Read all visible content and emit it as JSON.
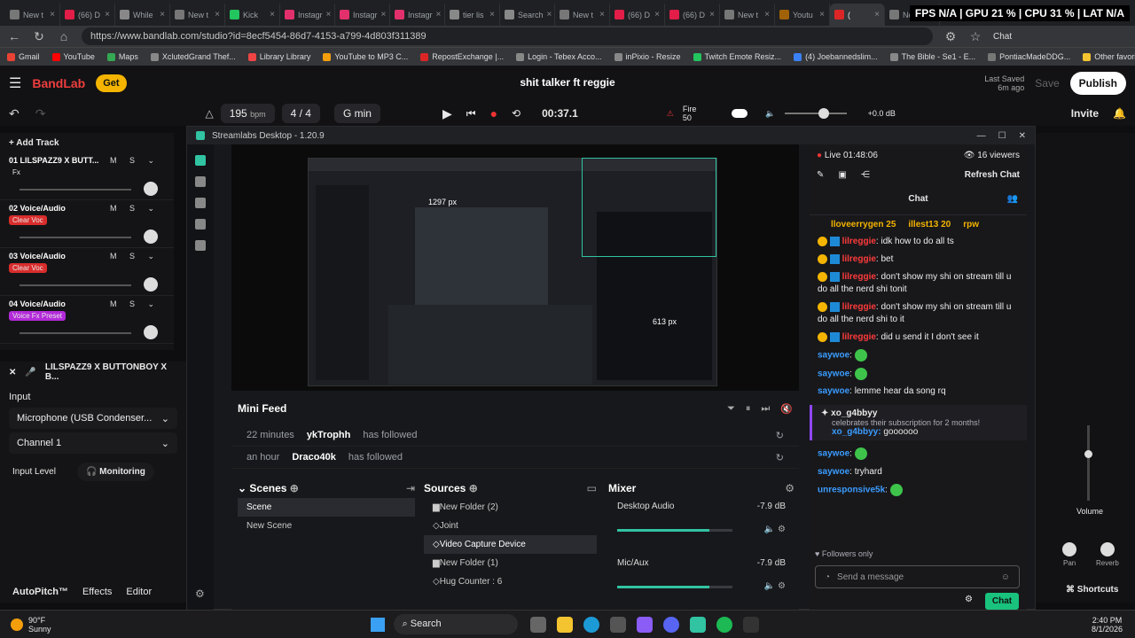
{
  "browser": {
    "tabs": [
      "New t",
      "(66) D",
      "While",
      "New t",
      "Kick",
      "Instagr",
      "Instagr",
      "Instagr",
      "tier lis",
      "Search",
      "New t",
      "(66) D",
      "(66) D",
      "New t",
      "Youtu",
      "(",
      "New t"
    ],
    "overlay": "FPS N/A | GPU 21 % | CPU 31 % | LAT N/A",
    "url": "https://www.bandlab.com/studio?id=8ecf5454-86d7-4153-a799-4d803f311389",
    "bookmarks": [
      "Gmail",
      "YouTube",
      "Maps",
      "XclutedGrand Thef...",
      "Library Library",
      "YouTube to MP3 C...",
      "RepostExchange |...",
      "Login - Tebex Acco...",
      "inPixio - Resize",
      "Twitch Emote Resiz...",
      "(4) Joebannedslim...",
      "The Bible - Se1 - E...",
      "PontiacMadeDDG...",
      "Other favorites"
    ],
    "profile_label": "Chat"
  },
  "bandlab": {
    "logo": "BandLab",
    "get_label": "Get",
    "song_title": "shit talker ft reggie",
    "last_saved_label": "Last Saved",
    "last_saved_time": "6m ago",
    "save_label": "Save",
    "publish_label": "Publish",
    "invite_label": "Invite",
    "bpm_value": "195",
    "bpm_unit": "bpm",
    "time_sig": "4 / 4",
    "key": "G min",
    "timecode": "00:37.1",
    "fire_label": "Fire",
    "fire_count": "50",
    "db_label": "+0.0 dB",
    "add_track": "Add Track",
    "tracks": [
      {
        "name": "01  LILSPAZZ9 X BUTT...",
        "fx": "Fx",
        "fx_color": "#141416"
      },
      {
        "name": "02  Voice/Audio",
        "fx": "Clear Voc",
        "fx_color": "#d92d2d"
      },
      {
        "name": "03  Voice/Audio",
        "fx": "Clear Voc",
        "fx_color": "#d92d2d"
      },
      {
        "name": "04  Voice/Audio",
        "fx": "Voice Fx Preset",
        "fx_color": "#b32ad9"
      }
    ],
    "inspector": {
      "track_title": "LILSPAZZ9 X BUTTONBOY X B...",
      "input_label": "Input",
      "input_device": "Microphone (USB Condenser...",
      "channel": "Channel 1",
      "input_level_label": "Input Level",
      "monitoring_label": "Monitoring"
    },
    "bottom_tabs": [
      "AutoPitch™",
      "Effects",
      "Editor"
    ],
    "right_labels": {
      "volume": "Volume",
      "pan": "Pan",
      "reverb": "Reverb",
      "shortcuts": "Shortcuts"
    }
  },
  "streamlabs": {
    "title": "Streamlabs Desktop - 1.20.9",
    "preview_px_top": "1297 px",
    "preview_px_right": "613 px",
    "minifeed_title": "Mini Feed",
    "feed": [
      {
        "time": "22 minutes",
        "user": "ykTrophh",
        "action": "has followed"
      },
      {
        "time": "an hour",
        "user": "Draco40k",
        "action": "has followed"
      }
    ],
    "scenes_title": "Scenes",
    "scenes": [
      "Scene",
      "New Scene"
    ],
    "sources_title": "Sources",
    "sources": [
      "New Folder (2)",
      "Joint",
      "Video Capture Device",
      "New Folder (1)",
      "Hug Counter : 6"
    ],
    "mixer_title": "Mixer",
    "mixer": [
      {
        "name": "Desktop Audio",
        "db": "-7.9 dB",
        "level": 0.8
      },
      {
        "name": "Mic/Aux",
        "db": "-7.9 dB",
        "level": 0.8
      }
    ]
  },
  "chat": {
    "live_label": "Live 01:48:06",
    "viewers": "16 viewers",
    "refresh_label": "Refresh Chat",
    "tab_label": "Chat",
    "top_row": [
      "lloveerrygen 25",
      "illest13 20",
      "rpw"
    ],
    "messages": [
      {
        "user": "lilreggie",
        "text": "idk how to do all ts"
      },
      {
        "user": "lilreggie",
        "text": "bet"
      },
      {
        "user": "lilreggie",
        "text": "don't show my shi on stream till u do all the nerd shi tonit"
      },
      {
        "user": "lilreggie",
        "text": "don't show my shi on stream till u do all the nerd shi to it"
      },
      {
        "user": "lilreggie",
        "text": "did u send it I don't see it"
      },
      {
        "user": "saywoe",
        "text": ""
      },
      {
        "user": "saywoe",
        "text": ""
      },
      {
        "user": "saywoe",
        "text": "lemme hear da song rq"
      }
    ],
    "sub_user": "xo_g4bbyy",
    "sub_text": "celebrates their subscription for 2 months!",
    "sub_msg_user": "xo_g4bbyy:",
    "sub_msg_text": "goooooo",
    "after": [
      {
        "user": "saywoe",
        "text": ""
      },
      {
        "user": "saywoe",
        "text": "tryhard"
      },
      {
        "user": "unresponsive5k",
        "text": ""
      }
    ],
    "followers_only": "Followers only",
    "input_placeholder": "Send a message",
    "chat_button": "Chat"
  },
  "taskbar": {
    "weather_temp": "90°F",
    "weather_desc": "Sunny",
    "search_label": "Search",
    "time": "2:40 PM",
    "date": "8/1/2026"
  }
}
